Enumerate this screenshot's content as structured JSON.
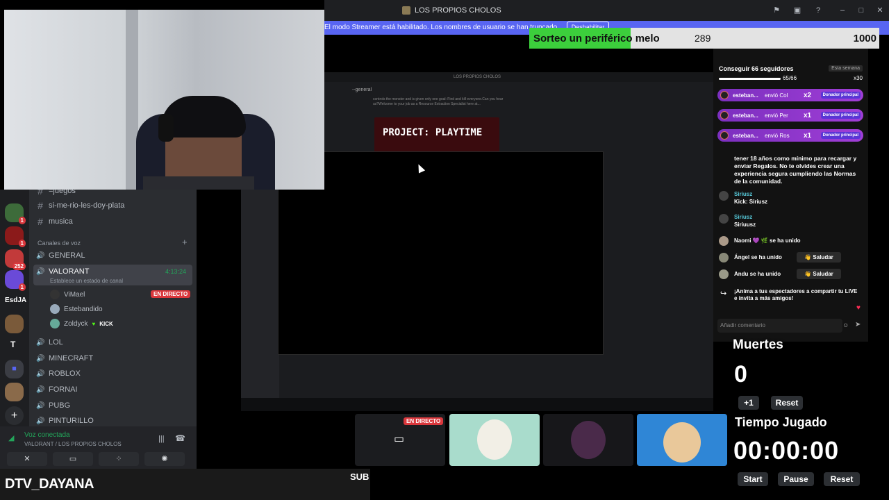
{
  "window": {
    "title": "LOS PROPIOS CHOLOS",
    "icons": [
      "flag-icon",
      "inbox-icon",
      "help-icon",
      "minimize-icon",
      "maximize-icon",
      "close-icon"
    ]
  },
  "streamer_banner": {
    "text": "El modo Streamer está habilitado. Los nombres de usuario se han truncado.",
    "button": "Deshabilitar"
  },
  "giveaway": {
    "label": "Sorteo un periférico melo",
    "current": "289",
    "goal": "1000",
    "progress": 0.289,
    "fill_color": "#3ccf3c"
  },
  "sidebar": {
    "servers": [
      {
        "badge": "1"
      },
      {
        "badge": "1"
      },
      {
        "badge": "252"
      },
      {
        "badge": "1"
      },
      {
        "label": "EsdJA"
      },
      {
        "label": ""
      },
      {
        "label": "T"
      },
      {
        "label": ""
      },
      {
        "label": ""
      }
    ],
    "text_channels": [
      {
        "name": "=juegos"
      },
      {
        "name": "si-me-rio-les-doy-plata"
      },
      {
        "name": "musica"
      }
    ],
    "voice_category": "Canales de voz",
    "voice_channels": [
      {
        "name": "GENERAL"
      },
      {
        "name": "VALORANT",
        "time": "4:13:24",
        "status": "Establece un estado de canal"
      },
      {
        "name": "LOL"
      },
      {
        "name": "MINECRAFT"
      },
      {
        "name": "ROBLOX"
      },
      {
        "name": "FORNAI"
      },
      {
        "name": "PUBG"
      },
      {
        "name": "PINTURILLO"
      }
    ],
    "voice_users": [
      {
        "name": "ViMael",
        "badge": "EN DIRECTO"
      },
      {
        "name": "Estebandido"
      },
      {
        "name": "Zoldyck",
        "tag": "KICK"
      }
    ]
  },
  "voice_connected": {
    "status": "Voz conectada",
    "channel": "VALORANT / LOS PROPIOS CHOLOS"
  },
  "streamer_name": "DTV_DAYANA",
  "sub_label": "SUB",
  "inner_window": {
    "title": "LOS PROPIOS CHOLOS",
    "channel": "--general",
    "game_title": "PROJECT: PLAYTIME",
    "message_preview": "controls the monster and is given only one goal: Find and kill everyone.Can you hear us?Welcome to your job as a Resource Extraction Specialist here at..."
  },
  "chat": {
    "goal_title": "Conseguir 66 seguidores",
    "goal_period": "Esta semana",
    "goal_progress": "65/66",
    "goal_fraction": 0.985,
    "multiplier": "x30",
    "gifts": [
      {
        "user": "esteban...",
        "text": "envió Col",
        "count": "x2",
        "tag": "Donador principal"
      },
      {
        "user": "esteban...",
        "text": "envió Per",
        "count": "x1",
        "tag": "Donador principal"
      },
      {
        "user": "esteban...",
        "text": "envió Ros",
        "count": "x1",
        "tag": "Donador principal"
      }
    ],
    "rules": "tener 18 años como mínimo para recargar y enviar Regalos. No te olvides crear una experiencia segura cumpliendo las Normas de la comunidad.",
    "messages": [
      {
        "user": "Siriusz",
        "text": "Kick: Siriusz"
      },
      {
        "user": "Siriusz",
        "text": "Siriuusz"
      }
    ],
    "joins": [
      {
        "text": "Naomi 💜 🌿 se ha unido"
      },
      {
        "text": "Ángel se ha unido",
        "action": "Saludar"
      },
      {
        "text": "Andu se ha unido",
        "action": "Saludar"
      }
    ],
    "share_prompt": "¡Anima a tus espectadores a compartir tu LIVE e invita a más amigos!",
    "comment_placeholder": "Añadir comentario"
  },
  "deaths": {
    "title": "Muertes",
    "count": "0",
    "plus": "+1",
    "reset": "Reset"
  },
  "timer": {
    "title": "Tiempo Jugado",
    "value": "00:00:00",
    "start": "Start",
    "pause": "Pause",
    "reset": "Reset"
  },
  "thumbnails": {
    "live_badge": "EN DIRECTO"
  }
}
